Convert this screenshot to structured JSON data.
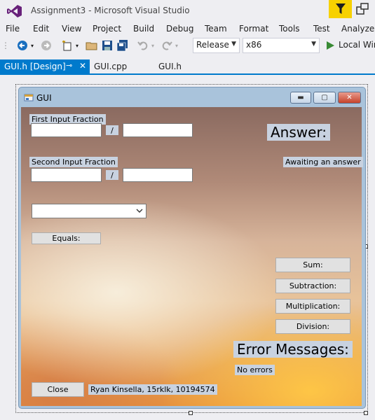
{
  "window": {
    "title": "Assignment3 - Microsoft Visual Studio"
  },
  "menu": [
    "File",
    "Edit",
    "View",
    "Project",
    "Build",
    "Debug",
    "Team",
    "Format",
    "Tools",
    "Test",
    "Analyze"
  ],
  "toolbar": {
    "config": "Release",
    "platform": "x86",
    "run_label": "Local Win"
  },
  "tabs": [
    {
      "label": "GUI.h [Design]",
      "pin": "⬤",
      "close": "✕"
    },
    {
      "label": "GUI.cpp"
    },
    {
      "label": "GUI.h"
    }
  ],
  "form": {
    "caption": "GUI",
    "first_label": "First Input Fraction",
    "second_label": "Second Input Fraction",
    "slash": "/",
    "answer_title": "Answer:",
    "answer_value": "Awaiting an answer",
    "operation_value": "",
    "equals_label": "Equals:",
    "sum_label": "Sum:",
    "subtraction_label": "Subtraction:",
    "multiplication_label": "Multiplication:",
    "division_label": "Division:",
    "errors_title": "Error Messages:",
    "errors_value": "No errors",
    "close_label": "Close",
    "author": "Ryan Kinsella, 15rklk, 10194574"
  },
  "colors": {
    "accent": "#007acc",
    "filter": "#f7d100"
  }
}
